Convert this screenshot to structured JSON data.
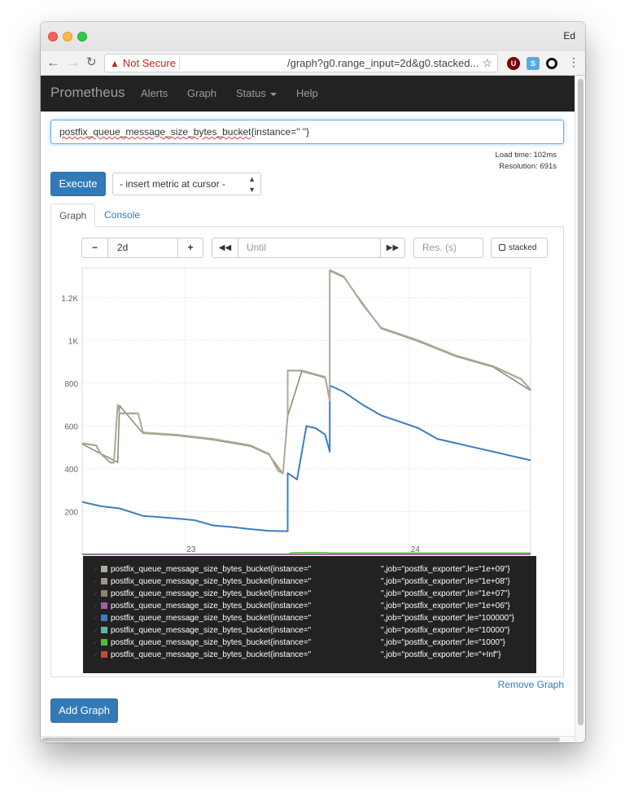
{
  "window": {
    "profile_name": "Ed"
  },
  "browser": {
    "security_label": "Not Secure",
    "url_path": "/graph?g0.range_input=2d&g0.stacked..."
  },
  "navbar": {
    "brand": "Prometheus",
    "items": [
      "Alerts",
      "Graph",
      "Status",
      "Help"
    ]
  },
  "query": {
    "metric_name": "postfix_queue_message_size_bytes_bucket",
    "expression_rest": "{instance=\"                    \"}"
  },
  "stats": {
    "load_time": "Load time: 102ms",
    "resolution": "Resolution: 691s"
  },
  "execute_label": "Execute",
  "insert_metric": "- insert metric at cursor -",
  "tabs": [
    "Graph",
    "Console"
  ],
  "graph_controls": {
    "minus": "−",
    "range": "2d",
    "plus": "+",
    "back": "◀◀",
    "until_placeholder": "Until",
    "forward": "▶▶",
    "resolution_placeholder": "Res. (s)",
    "stacked_label": "stacked"
  },
  "chart_data": {
    "type": "line",
    "x_ticks": [
      "23",
      "24"
    ],
    "y_ticks": [
      "200",
      "400",
      "600",
      "800",
      "1K",
      "1.2K"
    ],
    "ylim": [
      0,
      1340
    ],
    "xlim": [
      0,
      48
    ],
    "grid": true,
    "series": [
      {
        "name": "postfix_queue_message_size_bytes_bucket{instance=\"                    \",job=\"postfix_exporter\",le=\"1e+09\"}",
        "color": "#b0a99a",
        "x": [
          0,
          1.5,
          2,
          3,
          3.4,
          3.8,
          4,
          6,
          6.5,
          10,
          14,
          18,
          20,
          20.5,
          21,
          21.5,
          22,
          22,
          23.5,
          26,
          26.5,
          26.5,
          28,
          30,
          32,
          36,
          40,
          44,
          47,
          48
        ],
        "y": [
          520,
          510,
          470,
          430,
          430,
          700,
          660,
          660,
          570,
          560,
          540,
          510,
          470,
          430,
          390,
          380,
          650,
          860,
          860,
          830,
          720,
          1330,
          1300,
          1170,
          1060,
          1000,
          930,
          880,
          820,
          770
        ]
      },
      {
        "name": "postfix_queue_message_size_bytes_bucket{instance=\"                    \",job=\"postfix_exporter\",le=\"1e+08\"}",
        "color": "#9e9585",
        "x": [
          0,
          1.5,
          2,
          3,
          3.4,
          3.8,
          4,
          6,
          6.5,
          10,
          14,
          18,
          20,
          20.5,
          21,
          21.5,
          22,
          22,
          23.5,
          26,
          26.5,
          26.5,
          28,
          30,
          32,
          36,
          40,
          44,
          47,
          48
        ],
        "y": [
          518,
          508,
          468,
          428,
          428,
          698,
          658,
          658,
          568,
          558,
          538,
          508,
          468,
          428,
          388,
          378,
          648,
          858,
          858,
          828,
          718,
          1328,
          1298,
          1168,
          1058,
          998,
          928,
          878,
          818,
          768
        ]
      },
      {
        "name": "postfix_queue_message_size_bytes_bucket{instance=\"                    \",job=\"postfix_exporter\",le=\"1e+07\"}",
        "color": "#8c8374",
        "x": [
          0,
          3.8,
          4,
          6.5,
          10,
          14,
          18,
          20,
          21.5,
          22,
          23.5,
          26,
          26.5,
          26.5,
          28,
          32,
          36,
          40,
          44,
          48
        ],
        "y": [
          516,
          430,
          696,
          566,
          556,
          536,
          506,
          466,
          376,
          646,
          856,
          826,
          716,
          1326,
          1296,
          1056,
          996,
          926,
          876,
          766
        ]
      },
      {
        "name": "postfix_queue_message_size_bytes_bucket{instance=\"                    \",job=\"postfix_exporter\",le=\"1e+06\"}",
        "color": "#a0609a",
        "x": [
          0,
          48
        ],
        "y": [
          0,
          0
        ]
      },
      {
        "name": "postfix_queue_message_size_bytes_bucket{instance=\"                    \",job=\"postfix_exporter\",le=\"100000\"}",
        "color": "#3b7ec2",
        "x": [
          0,
          2,
          4,
          6.5,
          8,
          10,
          12,
          14,
          16,
          18,
          20,
          22,
          22,
          23,
          24,
          25,
          26,
          26.5,
          26.5,
          28,
          30,
          32,
          34,
          36,
          38,
          40,
          42,
          44,
          46,
          48
        ],
        "y": [
          245,
          225,
          215,
          180,
          175,
          168,
          160,
          135,
          128,
          118,
          110,
          108,
          380,
          350,
          600,
          590,
          560,
          480,
          790,
          760,
          700,
          650,
          620,
          590,
          540,
          520,
          500,
          480,
          460,
          440
        ]
      },
      {
        "name": "postfix_queue_message_size_bytes_bucket{instance=\"                    \",job=\"postfix_exporter\",le=\"10000\"}",
        "color": "#5fb3a8",
        "x": [
          0,
          48
        ],
        "y": [
          0,
          0
        ]
      },
      {
        "name": "postfix_queue_message_size_bytes_bucket{instance=\"                    \",job=\"postfix_exporter\",le=\"1000\"}",
        "color": "#57b93a",
        "x": [
          0,
          22,
          22.5,
          26,
          26.5,
          48
        ],
        "y": [
          0,
          0,
          8,
          8,
          6,
          6
        ]
      },
      {
        "name": "postfix_queue_message_size_bytes_bucket{instance=\"                    \",job=\"postfix_exporter\",le=\"+Inf\"}",
        "color": "#c24a3b",
        "x": [
          0,
          48
        ],
        "y": [
          0,
          0
        ]
      }
    ]
  },
  "legend": [
    {
      "metric": "postfix_queue_message_size_bytes_bucket{instance=\"",
      "labels": "\",job=\"postfix_exporter\",le=\"1e+09\"}",
      "color": "#b0a99a"
    },
    {
      "metric": "postfix_queue_message_size_bytes_bucket{instance=\"",
      "labels": "\",job=\"postfix_exporter\",le=\"1e+08\"}",
      "color": "#9e9585"
    },
    {
      "metric": "postfix_queue_message_size_bytes_bucket{instance=\"",
      "labels": "\",job=\"postfix_exporter\",le=\"1e+07\"}",
      "color": "#8c8374"
    },
    {
      "metric": "postfix_queue_message_size_bytes_bucket{instance=\"",
      "labels": "\",job=\"postfix_exporter\",le=\"1e+06\"}",
      "color": "#a0609a"
    },
    {
      "metric": "postfix_queue_message_size_bytes_bucket{instance=\"",
      "labels": "\",job=\"postfix_exporter\",le=\"100000\"}",
      "color": "#3b7ec2"
    },
    {
      "metric": "postfix_queue_message_size_bytes_bucket{instance=\"",
      "labels": "\",job=\"postfix_exporter\",le=\"10000\"}",
      "color": "#5fb3a8"
    },
    {
      "metric": "postfix_queue_message_size_bytes_bucket{instance=\"",
      "labels": "\",job=\"postfix_exporter\",le=\"1000\"}",
      "color": "#57b93a"
    },
    {
      "metric": "postfix_queue_message_size_bytes_bucket{instance=\"",
      "labels": "\",job=\"postfix_exporter\",le=\"+Inf\"}",
      "color": "#c24a3b"
    }
  ],
  "remove_graph": "Remove Graph",
  "add_graph": "Add Graph"
}
